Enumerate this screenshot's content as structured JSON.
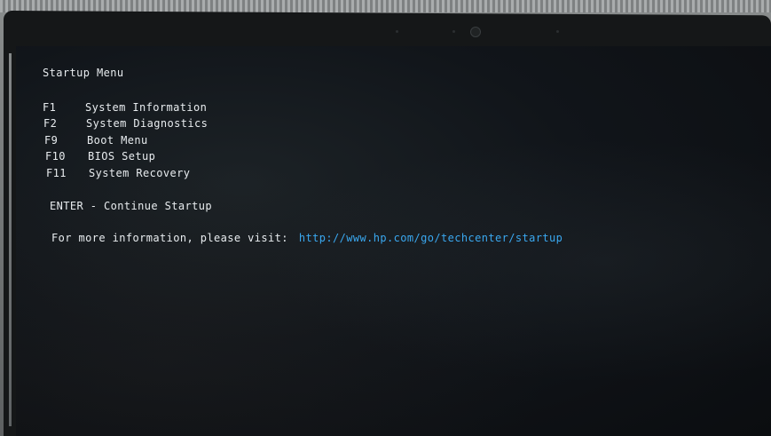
{
  "startup_menu": {
    "title": "Startup Menu",
    "options": [
      {
        "key": "F1",
        "label": "System Information"
      },
      {
        "key": "F2",
        "label": "System Diagnostics"
      },
      {
        "key": "F9",
        "label": "Boot Menu"
      },
      {
        "key": "F10",
        "label": "BIOS Setup"
      },
      {
        "key": "F11",
        "label": "System Recovery"
      }
    ],
    "enter_line": "ENTER - Continue Startup",
    "info_prefix": "For more information, please visit:",
    "info_url": "http://www.hp.com/go/techcenter/startup"
  },
  "colors": {
    "text": "#e8ecef",
    "link": "#3aa8f0",
    "screen_bg": "#11151a"
  }
}
